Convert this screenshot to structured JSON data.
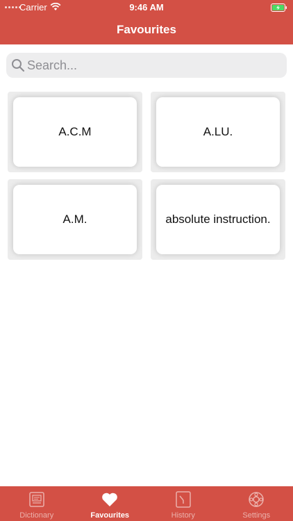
{
  "status_bar": {
    "carrier": "Carrier",
    "time": "9:46 AM"
  },
  "header": {
    "title": "Favourites"
  },
  "search": {
    "placeholder": "Search..."
  },
  "favourites": [
    "A.C.M",
    "A.LU.",
    "A.M.",
    "absolute instruction."
  ],
  "tabs": [
    {
      "label": "Dictionary",
      "icon": "dictionary-icon",
      "active": false
    },
    {
      "label": "Favourites",
      "icon": "heart-icon",
      "active": true
    },
    {
      "label": "History",
      "icon": "history-icon",
      "active": false
    },
    {
      "label": "Settings",
      "icon": "settings-icon",
      "active": false
    }
  ],
  "colors": {
    "accent": "#d35045",
    "card_bg": "#ffffff",
    "card_surround": "#ececec"
  }
}
